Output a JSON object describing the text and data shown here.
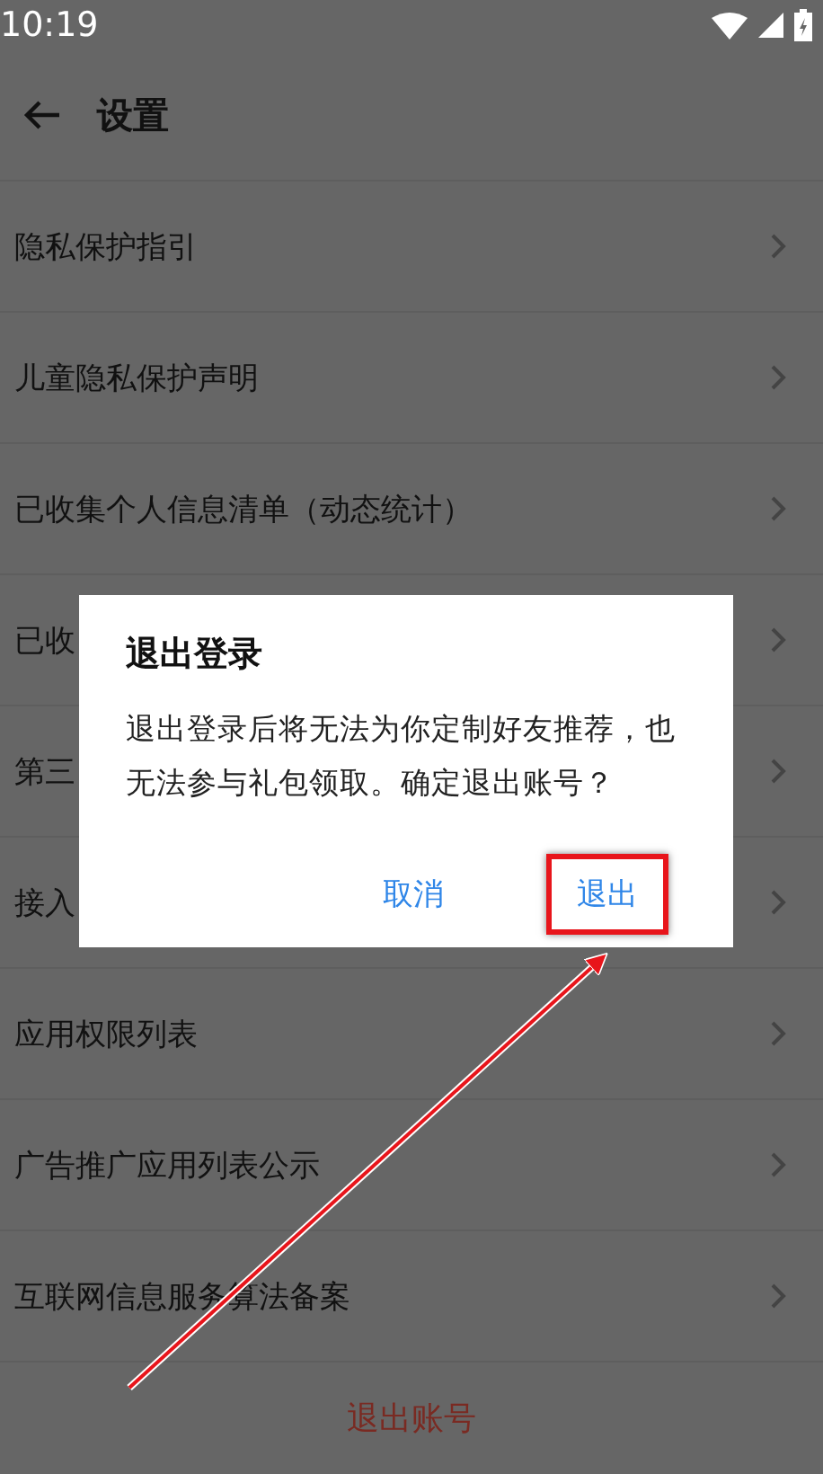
{
  "status_bar": {
    "time": "10:19"
  },
  "header": {
    "title": "设置"
  },
  "items": [
    {
      "label": "隐私保护指引"
    },
    {
      "label": "儿童隐私保护声明"
    },
    {
      "label": "已收集个人信息清单（动态统计）"
    },
    {
      "label": "已收"
    },
    {
      "label": "第三"
    },
    {
      "label": "接入"
    },
    {
      "label": "应用权限列表"
    },
    {
      "label": "广告推广应用列表公示"
    },
    {
      "label": "互联网信息服务算法备案"
    }
  ],
  "logout_button": "退出账号",
  "dialog": {
    "title": "退出登录",
    "message": "退出登录后将无法为你定制好友推荐，也无法参与礼包领取。确定退出账号？",
    "buttons": [
      {
        "label": "取消",
        "highlighted": false
      },
      {
        "label": "退出",
        "highlighted": true
      }
    ]
  }
}
